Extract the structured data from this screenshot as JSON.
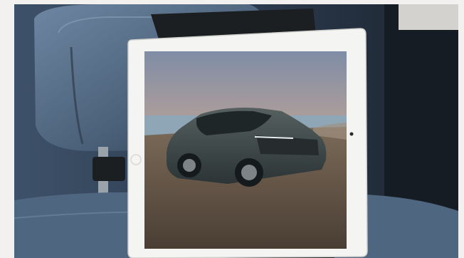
{
  "image": {
    "subject": "tablet-in-headrest-mount",
    "icons": [
      "tablet-home-button-icon",
      "tablet-camera-icon"
    ],
    "colors": {
      "page_margin": "#f2f1ef",
      "seat_leather": "#4a6078",
      "tablet_bezel": "#f4f4f2",
      "mount_clamp": "#1c1f22",
      "car_body": "#3b4548",
      "sky_top": "#7f8da6",
      "sky_horizon": "#e4b48e",
      "sea": "#8ea6b6",
      "ground": "#6b5a4a"
    }
  }
}
